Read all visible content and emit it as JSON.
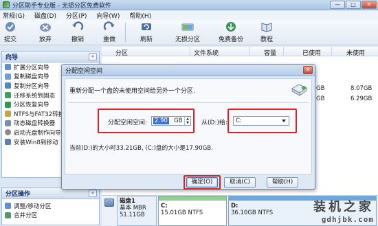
{
  "window": {
    "title": "分区助手专业版 - 无损分区免费软件",
    "controls": [
      "—",
      "□",
      "✕"
    ]
  },
  "menubar": [
    "常规(G)",
    "磁盘(D)",
    "分区(P)",
    "向导(W)",
    "帮助(H)"
  ],
  "toolbar": {
    "buttons": [
      {
        "label": "提交",
        "icon": "check-icon"
      },
      {
        "label": "放弃",
        "icon": "discard-icon"
      },
      {
        "label": "撤销",
        "icon": "undo-icon"
      },
      {
        "label": "重做",
        "icon": "redo-icon"
      },
      {
        "label": "刷新",
        "icon": "refresh-icon"
      },
      {
        "label": "无损分区",
        "icon": "partition-icon"
      },
      {
        "label": "免费备份",
        "icon": "backup-icon"
      },
      {
        "label": "教程",
        "icon": "tutorial-icon"
      }
    ]
  },
  "sidebar": {
    "wizard": {
      "title": "向导",
      "collapse": "«",
      "items": [
        "扩展分区向导",
        "复制磁盘向导",
        "复制分区向导",
        "迁移系统到固态",
        "分区恢复向导",
        "NTFS与FAT32转换",
        "动态磁盘转换器",
        "启动光盘制作向导",
        "安装Win8到移动"
      ]
    },
    "ops": {
      "title": "分区操作",
      "collapse": "«",
      "items": [
        "调整/移动分区",
        "合并分区"
      ]
    }
  },
  "table": {
    "columns": [
      "分区",
      "文件系统",
      "容量",
      "已使用",
      "未使用"
    ],
    "rows": [
      {
        "capacity_frag": "GB",
        "unused": "8.07GB"
      },
      {
        "capacity_frag": "GB",
        "unused": "6.29GB"
      }
    ]
  },
  "disk": {
    "name": "磁盘1",
    "type": "基本 MBR",
    "size": "51.11GB",
    "partitions": [
      {
        "name": "C:",
        "detail": "15.01GB NTFS"
      },
      {
        "name": "D:",
        "detail": "36.10GB NTFS"
      }
    ]
  },
  "dialog": {
    "title": "分配空闲空间",
    "description": "重新分配一个盘的未使用空间给另外一个分区.",
    "alloc_label": "分配空闲空间:",
    "alloc_value": "2.90",
    "alloc_unit": "GB",
    "from_label": "从(D:)给:",
    "target_value": "C:",
    "info": "当前(D:)的大小时33.21GB, (C:)盘的大小是17.90GB.",
    "ok": "确定(O)",
    "cancel": "取消(C)",
    "help": "帮助(H)",
    "close": "✕"
  },
  "watermark": {
    "brand": "装机之家",
    "url": "gdhjbk.com"
  },
  "colors": {
    "highlight_box": "#e02020",
    "accent_blue": "#3a6fd0",
    "partition_c": "#8fd18f",
    "partition_d": "#6aa9e0"
  }
}
